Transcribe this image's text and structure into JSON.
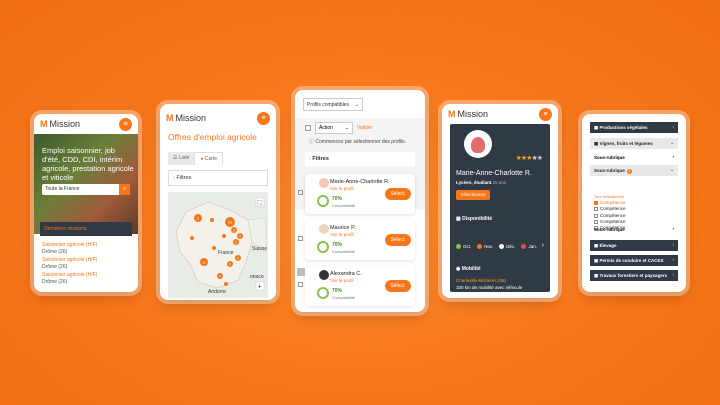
{
  "brand": {
    "logo_mark": "M",
    "logo_text": "Mission"
  },
  "phone1": {
    "hero_text": "Emploi saisonnier, job d'été, CDD, CDI, intérim agricole, prestation agricole et viticole",
    "search_placeholder": "Toute la France",
    "latest_title": "Dernières missions",
    "jobs": [
      {
        "title": "Saisonnier agricole (H/F)",
        "location": "Drôme (26)"
      },
      {
        "title": "Saisonnier agricole (H/F)",
        "location": "Drôme (26)"
      },
      {
        "title": "Saisonnier agricole (H/F)",
        "location": "Drôme (26)"
      }
    ]
  },
  "phone2": {
    "title": "Offres d'emploi agricole",
    "tabs": [
      "Liste",
      "Carte"
    ],
    "filters": "Filtres",
    "map_labels": {
      "france": "France",
      "suisse": "Suisse",
      "andorre": "Andorre",
      "monaco": "onaco"
    },
    "clusters": [
      "3",
      "2",
      "23",
      "4",
      "2",
      "2",
      "3",
      "3",
      "4"
    ]
  },
  "phone3": {
    "select_label": "Profils compatibles",
    "action_label": "Action",
    "valider": "Valider",
    "info": "Commencez par sélectionner des profils.",
    "filters": "Filtres",
    "candidates": [
      {
        "name": "Marie-Anne-Charlotte R.",
        "link": "Voir le profil",
        "pct": "70%",
        "compat": "Compatibilité",
        "btn": "Sélect."
      },
      {
        "name": "Maurice P.",
        "link": "Voir le profil",
        "pct": "70%",
        "compat": "Compatibilité",
        "btn": "Sélect."
      },
      {
        "name": "Alexandra C.",
        "link": "Voir le profil",
        "pct": "70%",
        "compat": "Compatibilité",
        "btn": "Sélect."
      }
    ]
  },
  "phone4": {
    "name": "Marie-Anne-Charlotte R.",
    "status": "Lycéen, étudiant",
    "age": "25 ans",
    "select_btn": "Sélectionner",
    "dispo_title": "Disponibilité",
    "months": [
      "Oct.",
      "Nov.",
      "Déc.",
      "Jan."
    ],
    "month_colors": [
      "#8bc34a",
      "#f7761a",
      "#ffffff",
      "#e05050"
    ],
    "mobility_title": "Mobilité",
    "city": "Charleville-Mézières (08)",
    "radius": "100 km de mobilité avec véhicule",
    "stars_on": 3,
    "stars_total": 5
  },
  "phone5": {
    "rows_top": [
      "Productions végétales",
      "Vignes, fruits et légumes"
    ],
    "sous1": "Sous-rubrique",
    "sous1b": "Sous-rubrique",
    "tous": "Tout sélectionner",
    "competences": [
      "Compétence",
      "Compétence",
      "Compétence",
      "Compétence",
      "Compétence",
      "Compétence"
    ],
    "sous2": "Sous-rubrique",
    "rows_bottom": [
      "Élevage",
      "Permis de conduire et CACES",
      "Travaux forestiers et paysagers"
    ]
  }
}
